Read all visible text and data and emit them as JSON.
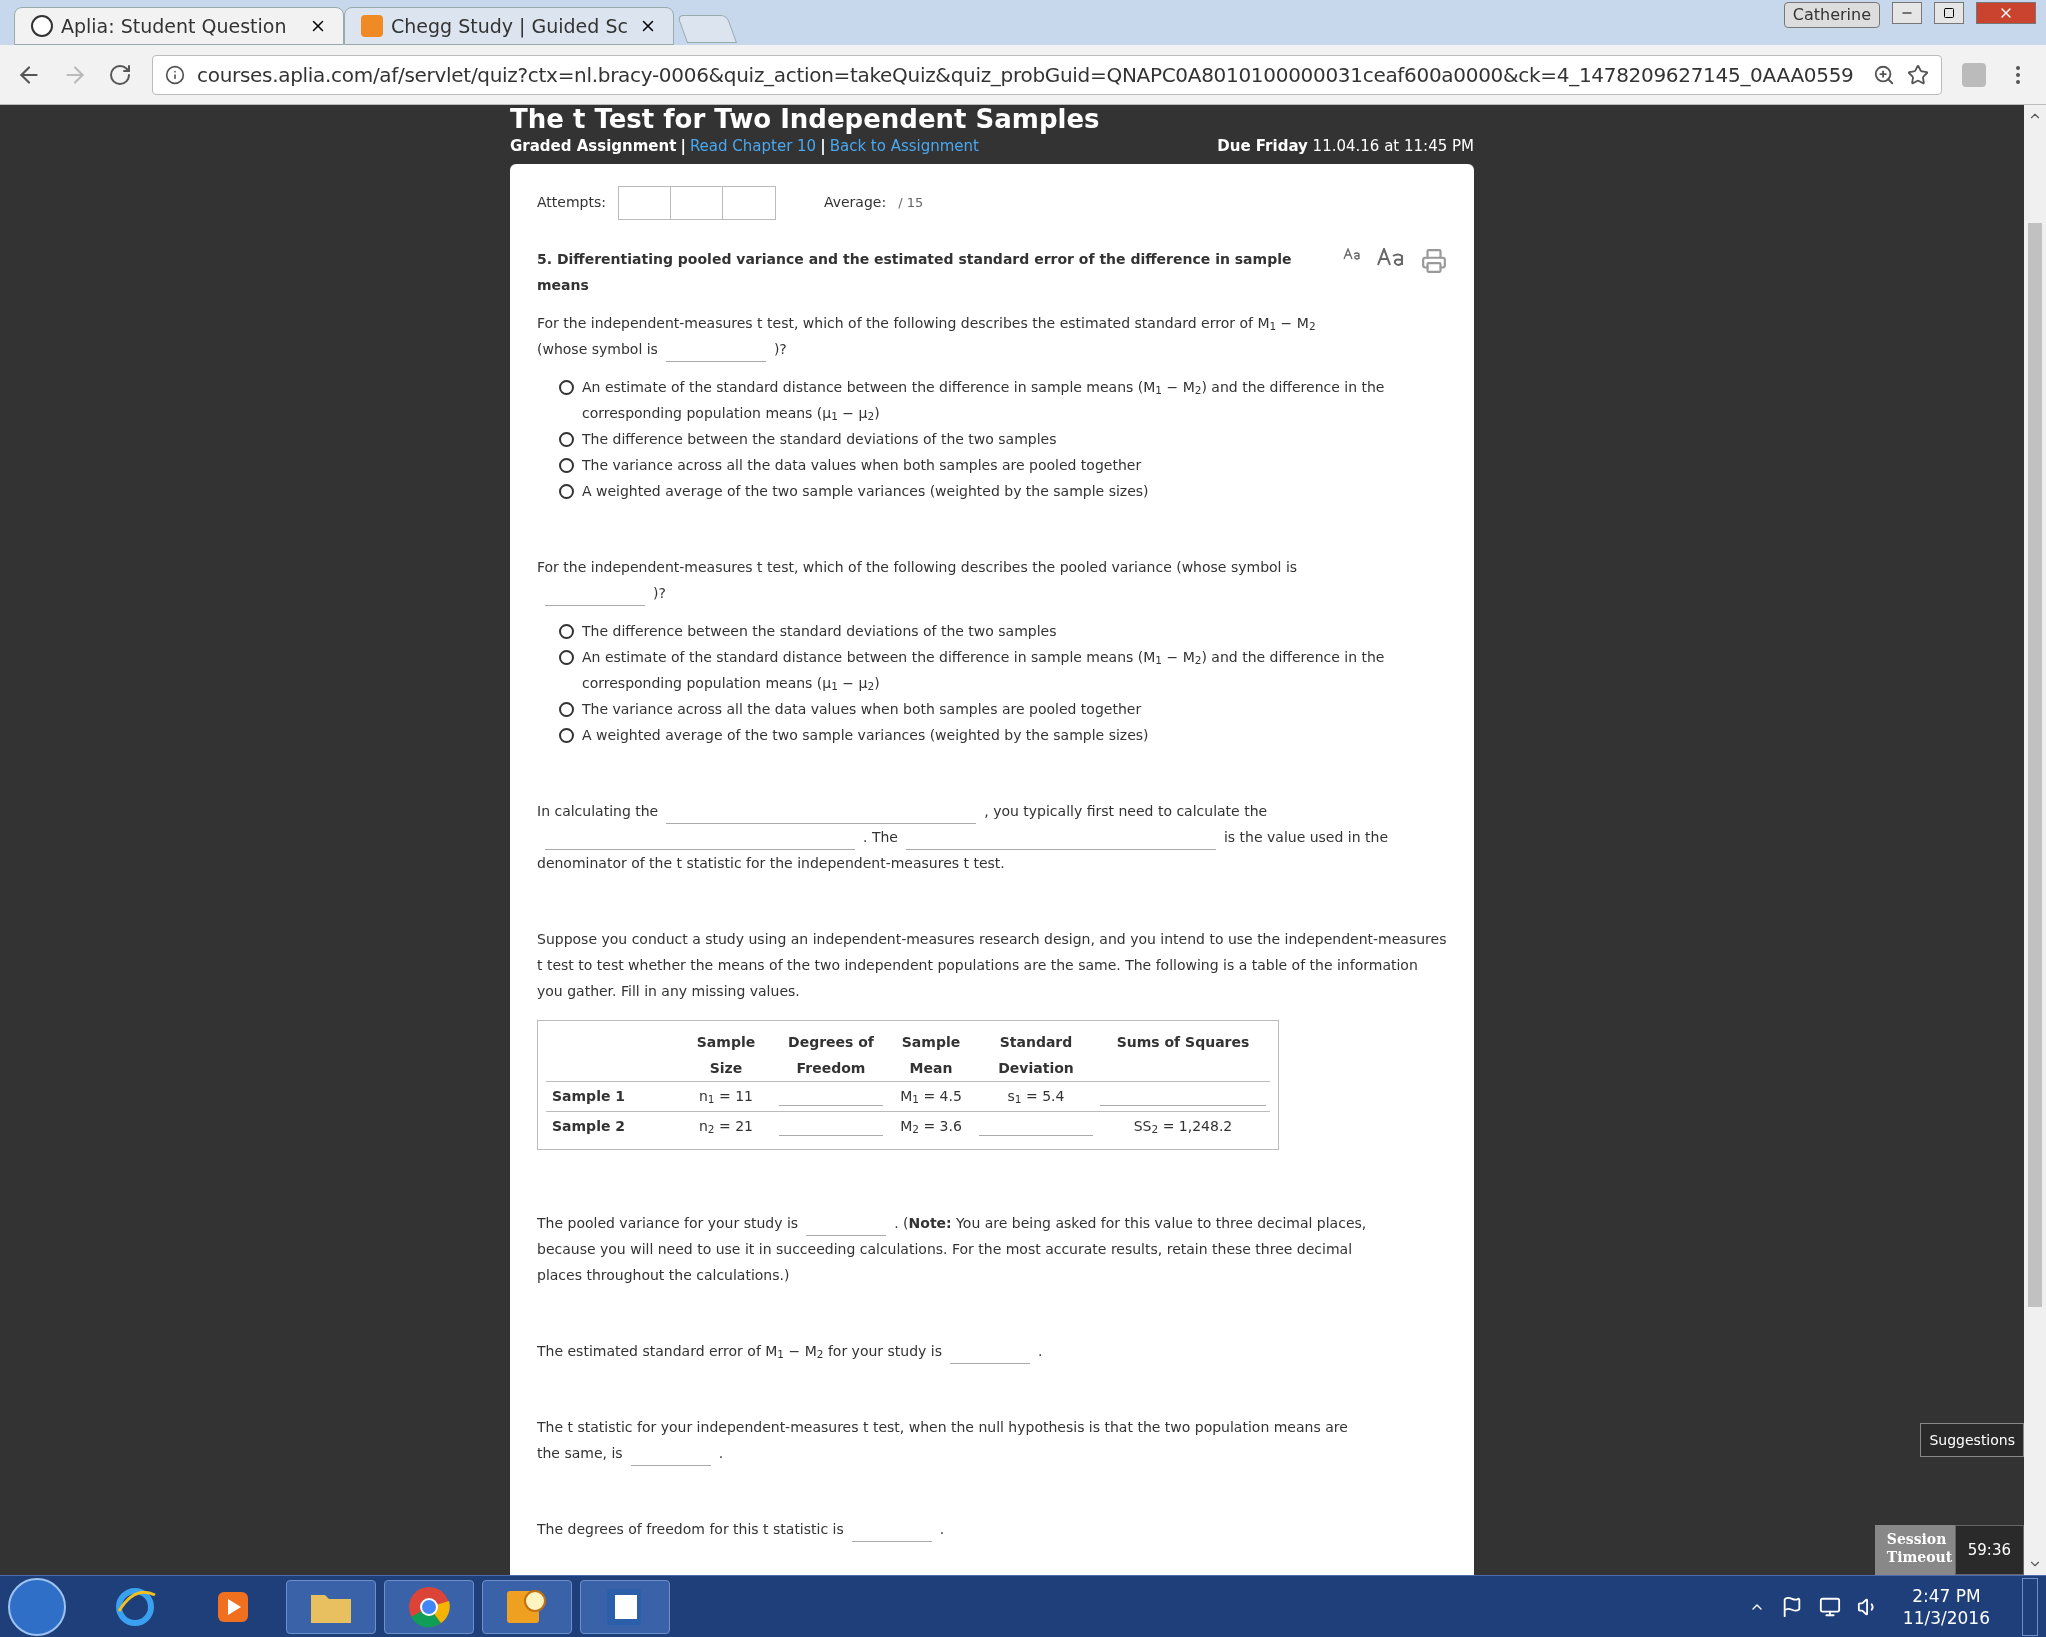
{
  "browser": {
    "tabs": [
      {
        "title": "Aplia: Student Question",
        "selected": true
      },
      {
        "title": "Chegg Study | Guided Sc",
        "selected": false
      }
    ],
    "profile": "Catherine",
    "url": "courses.aplia.com/af/servlet/quiz?ctx=nl.bracy-0006&quiz_action=takeQuiz&quiz_probGuid=QNAPC0A8010100000031ceaf600a0000&ck=4_1478209627145_0AAA0559"
  },
  "header": {
    "title": "The t Test for Two Independent Samples",
    "breadcrumb": [
      {
        "kind": "text",
        "text": "Graded Assignment"
      },
      {
        "kind": "separator",
        "text": "|"
      },
      {
        "kind": "link",
        "text": "Read Chapter 10"
      },
      {
        "kind": "separator",
        "text": "|"
      },
      {
        "kind": "link",
        "text": "Back to Assignment"
      }
    ],
    "due_label": "Due Friday",
    "due_value": "11.04.16 at 11:45 PM"
  },
  "scores": {
    "attempts_label": "Attempts:",
    "average_label": "Average:",
    "average_value": "/ 15"
  },
  "question": {
    "number": "5.",
    "title": "Differentiating pooled variance and the estimated standard error of the difference in sample means"
  },
  "sections": [
    {
      "kind": "choice",
      "prompt": [
        [
          {
            "kind": "text",
            "text": "For the independent-measures t test, which of the following describes the estimated standard error of M$_{1}$ − M$_{2}$"
          }
        ],
        [
          {
            "kind": "text",
            "text": "(whose symbol is"
          },
          {
            "kind": "blank"
          },
          {
            "kind": "text",
            "text": ")?"
          }
        ]
      ],
      "options": [
        {
          "text": "An estimate of the standard distance between the difference in sample means (M$_{1}$ − M$_{2}$) and the difference in the corresponding population means (μ$_{1}$ − μ$_{2}$)",
          "selected": false
        },
        {
          "text": "The difference between the standard deviations of the two samples",
          "selected": false
        },
        {
          "text": "The variance across all the data values when both samples are pooled together",
          "selected": false
        },
        {
          "text": "A weighted average of the two sample variances (weighted by the sample sizes)",
          "selected": false
        }
      ]
    },
    {
      "kind": "choice",
      "prompt": [
        [
          {
            "kind": "text",
            "text": "For the independent-measures t test, which of the following describes the pooled variance (whose symbol is"
          }
        ],
        [
          {
            "kind": "blank"
          },
          {
            "kind": "text",
            "text": ")?"
          }
        ]
      ],
      "options": [
        {
          "text": "The difference between the standard deviations of the two samples",
          "selected": false
        },
        {
          "text": "An estimate of the standard distance between the difference in sample means (M$_{1}$ − M$_{2}$) and the difference in the corresponding population means (μ$_{1}$ − μ$_{2}$)",
          "selected": false
        },
        {
          "text": "The variance across all the data values when both samples are pooled together",
          "selected": false
        },
        {
          "text": "A weighted average of the two sample variances (weighted by the sample sizes)",
          "selected": false
        }
      ]
    },
    {
      "kind": "fill",
      "prompt": [
        [
          {
            "kind": "text",
            "text": "In calculating the"
          },
          {
            "kind": "blank_long"
          },
          {
            "kind": "text",
            "text": ", you typically first need to calculate the"
          }
        ],
        [
          {
            "kind": "blank_long"
          },
          {
            "kind": "text",
            "text": ". The"
          },
          {
            "kind": "blank_long"
          },
          {
            "kind": "text",
            "text": "is the value used in the"
          }
        ],
        [
          {
            "kind": "text",
            "text": "denominator of the t statistic for the independent-measures t test."
          }
        ]
      ]
    },
    {
      "kind": "table",
      "prompt": [
        [
          {
            "kind": "text",
            "text": "Suppose you conduct a study using an independent-measures research design, and you intend to use the independent-measures t test to test whether the means of the two independent populations are the same. The following is a table of the information you gather. Fill in any missing values."
          }
        ]
      ],
      "columns": [
        "Sample Size",
        "Degrees of Freedom",
        "Sample Mean",
        "Standard Deviation",
        "Sums of Squares"
      ],
      "rows": [
        {
          "label": "Sample 1",
          "cells": [
            {
              "kind": "text",
              "text": "n$_{1}$ = 11"
            },
            {
              "kind": "blank"
            },
            {
              "kind": "text",
              "text": "M$_{1}$ = 4.5"
            },
            {
              "kind": "text",
              "text": "s$_{1}$ = 5.4"
            },
            {
              "kind": "blank"
            }
          ]
        },
        {
          "label": "Sample 2",
          "cells": [
            {
              "kind": "text",
              "text": "n$_{2}$ = 21"
            },
            {
              "kind": "blank"
            },
            {
              "kind": "text",
              "text": "M$_{2}$ = 3.6"
            },
            {
              "kind": "blank"
            },
            {
              "kind": "text",
              "text": "SS$_{2}$ = 1,248.2"
            }
          ]
        }
      ]
    },
    {
      "kind": "fill",
      "prompt": [
        [
          {
            "kind": "text",
            "text": "The pooled variance for your study is"
          },
          {
            "kind": "blank_short"
          },
          {
            "kind": "text",
            "text": ". (**Note:** You are being asked for this value to three decimal places,"
          }
        ],
        [
          {
            "kind": "text",
            "text": "because you will need to use it in succeeding calculations. For the most accurate results, retain these three decimal"
          }
        ],
        [
          {
            "kind": "text",
            "text": "places throughout the calculations.)"
          }
        ]
      ]
    },
    {
      "kind": "fill",
      "prompt": [
        [
          {
            "kind": "text",
            "text": "The estimated standard error of M$_{1}$ − M$_{2}$ for your study is"
          },
          {
            "kind": "blank_short"
          },
          {
            "kind": "text",
            "text": "."
          }
        ]
      ]
    },
    {
      "kind": "fill",
      "prompt": [
        [
          {
            "kind": "text",
            "text": "The t statistic for your independent-measures t test, when the null hypothesis is that the two population means are"
          }
        ],
        [
          {
            "kind": "text",
            "text": "the same, is"
          },
          {
            "kind": "blank_short"
          },
          {
            "kind": "text",
            "text": "."
          }
        ]
      ]
    },
    {
      "kind": "fill",
      "prompt": [
        [
          {
            "kind": "text",
            "text": "The degrees of freedom for this t statistic is"
          },
          {
            "kind": "blank_short"
          },
          {
            "kind": "text",
            "text": "."
          }
        ]
      ]
    }
  ],
  "widgets": {
    "suggestions": "Suggestions",
    "session_label": "Session Timeout",
    "session_time": "59:36"
  },
  "taskbar": {
    "time": "2:47 PM",
    "date": "11/3/2016"
  }
}
